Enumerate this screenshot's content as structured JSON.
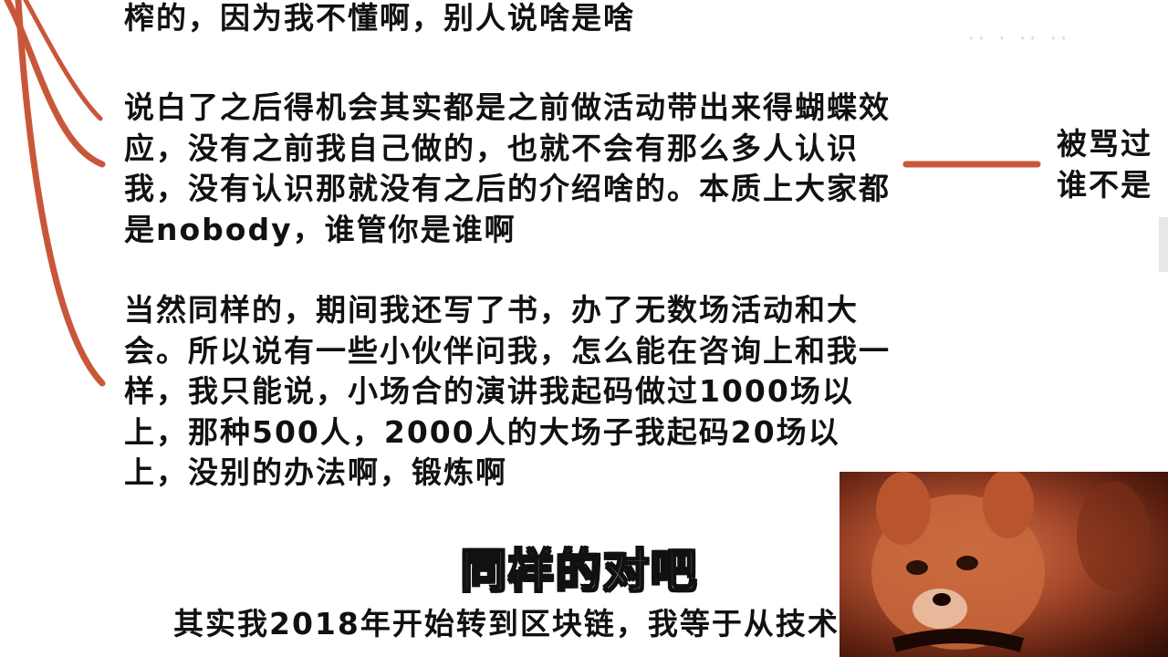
{
  "content": {
    "top_line": "榨的，因为我不懂啊，别人说啥是啥",
    "para2": "说白了之后得机会其实都是之前做活动带出来得蝴蝶效应，没有之前我自己做的，也就不会有那么多人认识我，没有认识那就没有之后的介绍啥的。本质上大家都是nobody，谁管你是谁啊",
    "para3": "当然同样的，期间我还写了书，办了无数场活动和大会。所以说有一些小伙伴问我，怎么能在咨询上和我一样，我只能说，小场合的演讲我起码做过1000场以上，那种500人，2000人的大场子我起码20场以上，没别的办法啊，锻炼啊",
    "right_snippet": "被骂过\n谁不是",
    "bottom_line": "其实我2018年开始转到区块链，我等于从技术"
  },
  "subtitle": "同样的对吧",
  "colors": {
    "connector": "#c8573a",
    "text": "#111111",
    "subtitle_fill": "#ffffff",
    "subtitle_stroke": "#111111"
  }
}
